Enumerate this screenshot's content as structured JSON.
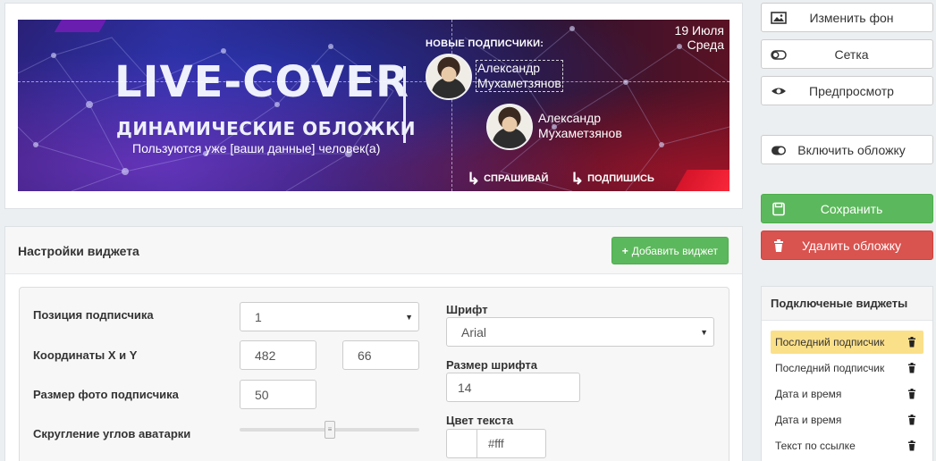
{
  "cover": {
    "logo": "LIVE-COVER",
    "subtitle": "ДИНАМИЧЕСКИЕ ОБЛОЖКИ",
    "users_count": "Пользуются уже [ваши данные] человек(а)",
    "new_subscribers": "НОВЫЕ ПОДПИСЧИКИ:",
    "subscriber1": [
      "Александр",
      "Мухаметзянов"
    ],
    "subscriber2": [
      "Александр",
      "Мухаметзянов"
    ],
    "date": "19 Июля",
    "weekday": "Среда",
    "cta_ask": "СПРАШИВАЙ",
    "cta_subscribe": "ПОДПИШИСЬ",
    "colors": {
      "bg_left": "#302a8e",
      "bg_right": "#5a1224",
      "accent_red": "#d5142a",
      "accent_purple": "#6a1eb0"
    }
  },
  "settings": {
    "title": "Настройки виджета",
    "add_button": "Добавить виджет",
    "position_label": "Позиция подписчика",
    "position_value": "1",
    "coords_label": "Координаты X и Y",
    "coord_x": "482",
    "coord_y": "66",
    "photo_size_label": "Размер фото подписчика",
    "photo_size_value": "50",
    "rounding_label": "Скругление углов аватарки",
    "font_label": "Шрифт",
    "font_value": "Arial",
    "font_size_label": "Размер шрифта",
    "font_size_value": "14",
    "text_color_label": "Цвет текста",
    "text_color_value": "#fff"
  },
  "sidebar": {
    "change_bg": "Изменить фон",
    "grid": "Сетка",
    "preview": "Предпросмотр",
    "enable_cover": "Включить обложку",
    "save": "Сохранить",
    "delete_cover": "Удалить обложку",
    "widgets_title": "Подключеные виджеты",
    "widgets": [
      "Последний подписчик",
      "Последний подписчик",
      "Дата и время",
      "Дата и время",
      "Текст по ссылке"
    ],
    "active_widget_index": 0,
    "colors": {
      "green": "#5cb85c",
      "red": "#d9534f",
      "highlight": "#fbe08a"
    }
  },
  "icons": [
    "image-icon",
    "toggle-icon",
    "eye-icon",
    "toggle-on-icon",
    "save-icon",
    "trash-icon",
    "plus-icon",
    "reply-arrow-icon",
    "chevron-down-icon"
  ]
}
